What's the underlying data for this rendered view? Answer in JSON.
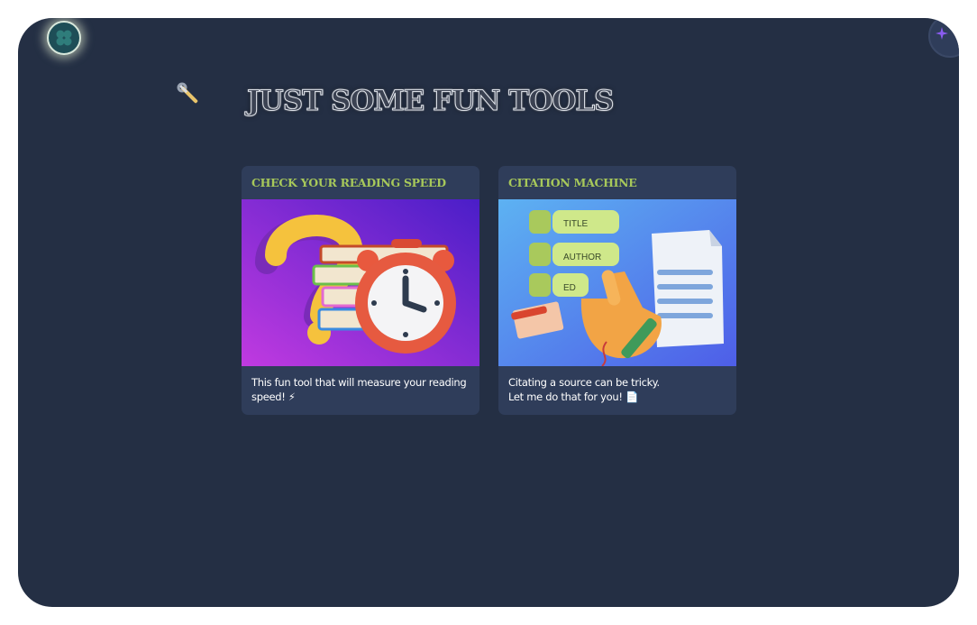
{
  "page": {
    "heading": "JUST SOME FUN TOOLS"
  },
  "header": {
    "avatar_icon": "clover-icon",
    "corner_icon": "sparkle-icon",
    "tools_icon": "wrench-screwdriver-icon"
  },
  "cards": [
    {
      "title": "CHECK YOUR READING SPEED",
      "desc_line1": "This fun tool that will measure your reading",
      "desc_line2": "speed! ⚡",
      "image_icon": "books-alarm-clock-illustration"
    },
    {
      "title": "CITATION MACHINE",
      "desc_line1": "Citating a source can be tricky.",
      "desc_line2": "Let me do that for you! 📄",
      "image_icon": "citation-hand-document-illustration",
      "image_labels": [
        "TITLE",
        "AUTHOR",
        "ED"
      ]
    }
  ],
  "colors": {
    "background": "#242f44",
    "card": "#2f3d5a",
    "card_title": "#a7c85a"
  }
}
